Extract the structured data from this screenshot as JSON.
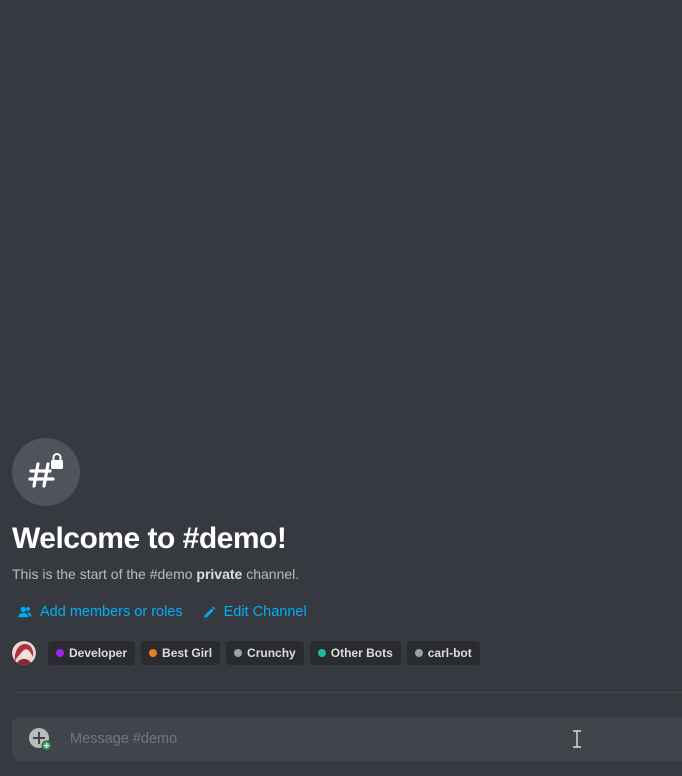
{
  "channel": {
    "name": "#demo",
    "icon": "hashtag-lock-icon"
  },
  "welcome": {
    "title": "Welcome to #demo!",
    "subtitle_prefix": "This is the start of the #demo ",
    "subtitle_bold": "private",
    "subtitle_suffix": " channel."
  },
  "actions": {
    "add_members_label": "Add members or roles",
    "add_members_icon": "add-members-icon",
    "edit_channel_label": "Edit Channel",
    "edit_channel_icon": "pencil-icon",
    "link_color": "#00b0f4"
  },
  "roles": [
    {
      "name": "Developer",
      "color": "#9b25ee"
    },
    {
      "name": "Best Girl",
      "color": "#e67e22"
    },
    {
      "name": "Crunchy",
      "color": "#95a5a6"
    },
    {
      "name": "Other Bots",
      "color": "#1abc9c"
    },
    {
      "name": "carl-bot",
      "color": "#95a5a6"
    }
  ],
  "composer": {
    "placeholder": "Message #demo",
    "attach_icon": "add-attachment-icon"
  },
  "colors": {
    "background": "#36393f",
    "composer_bg": "#40444b",
    "pill_bg": "#292b2f"
  }
}
